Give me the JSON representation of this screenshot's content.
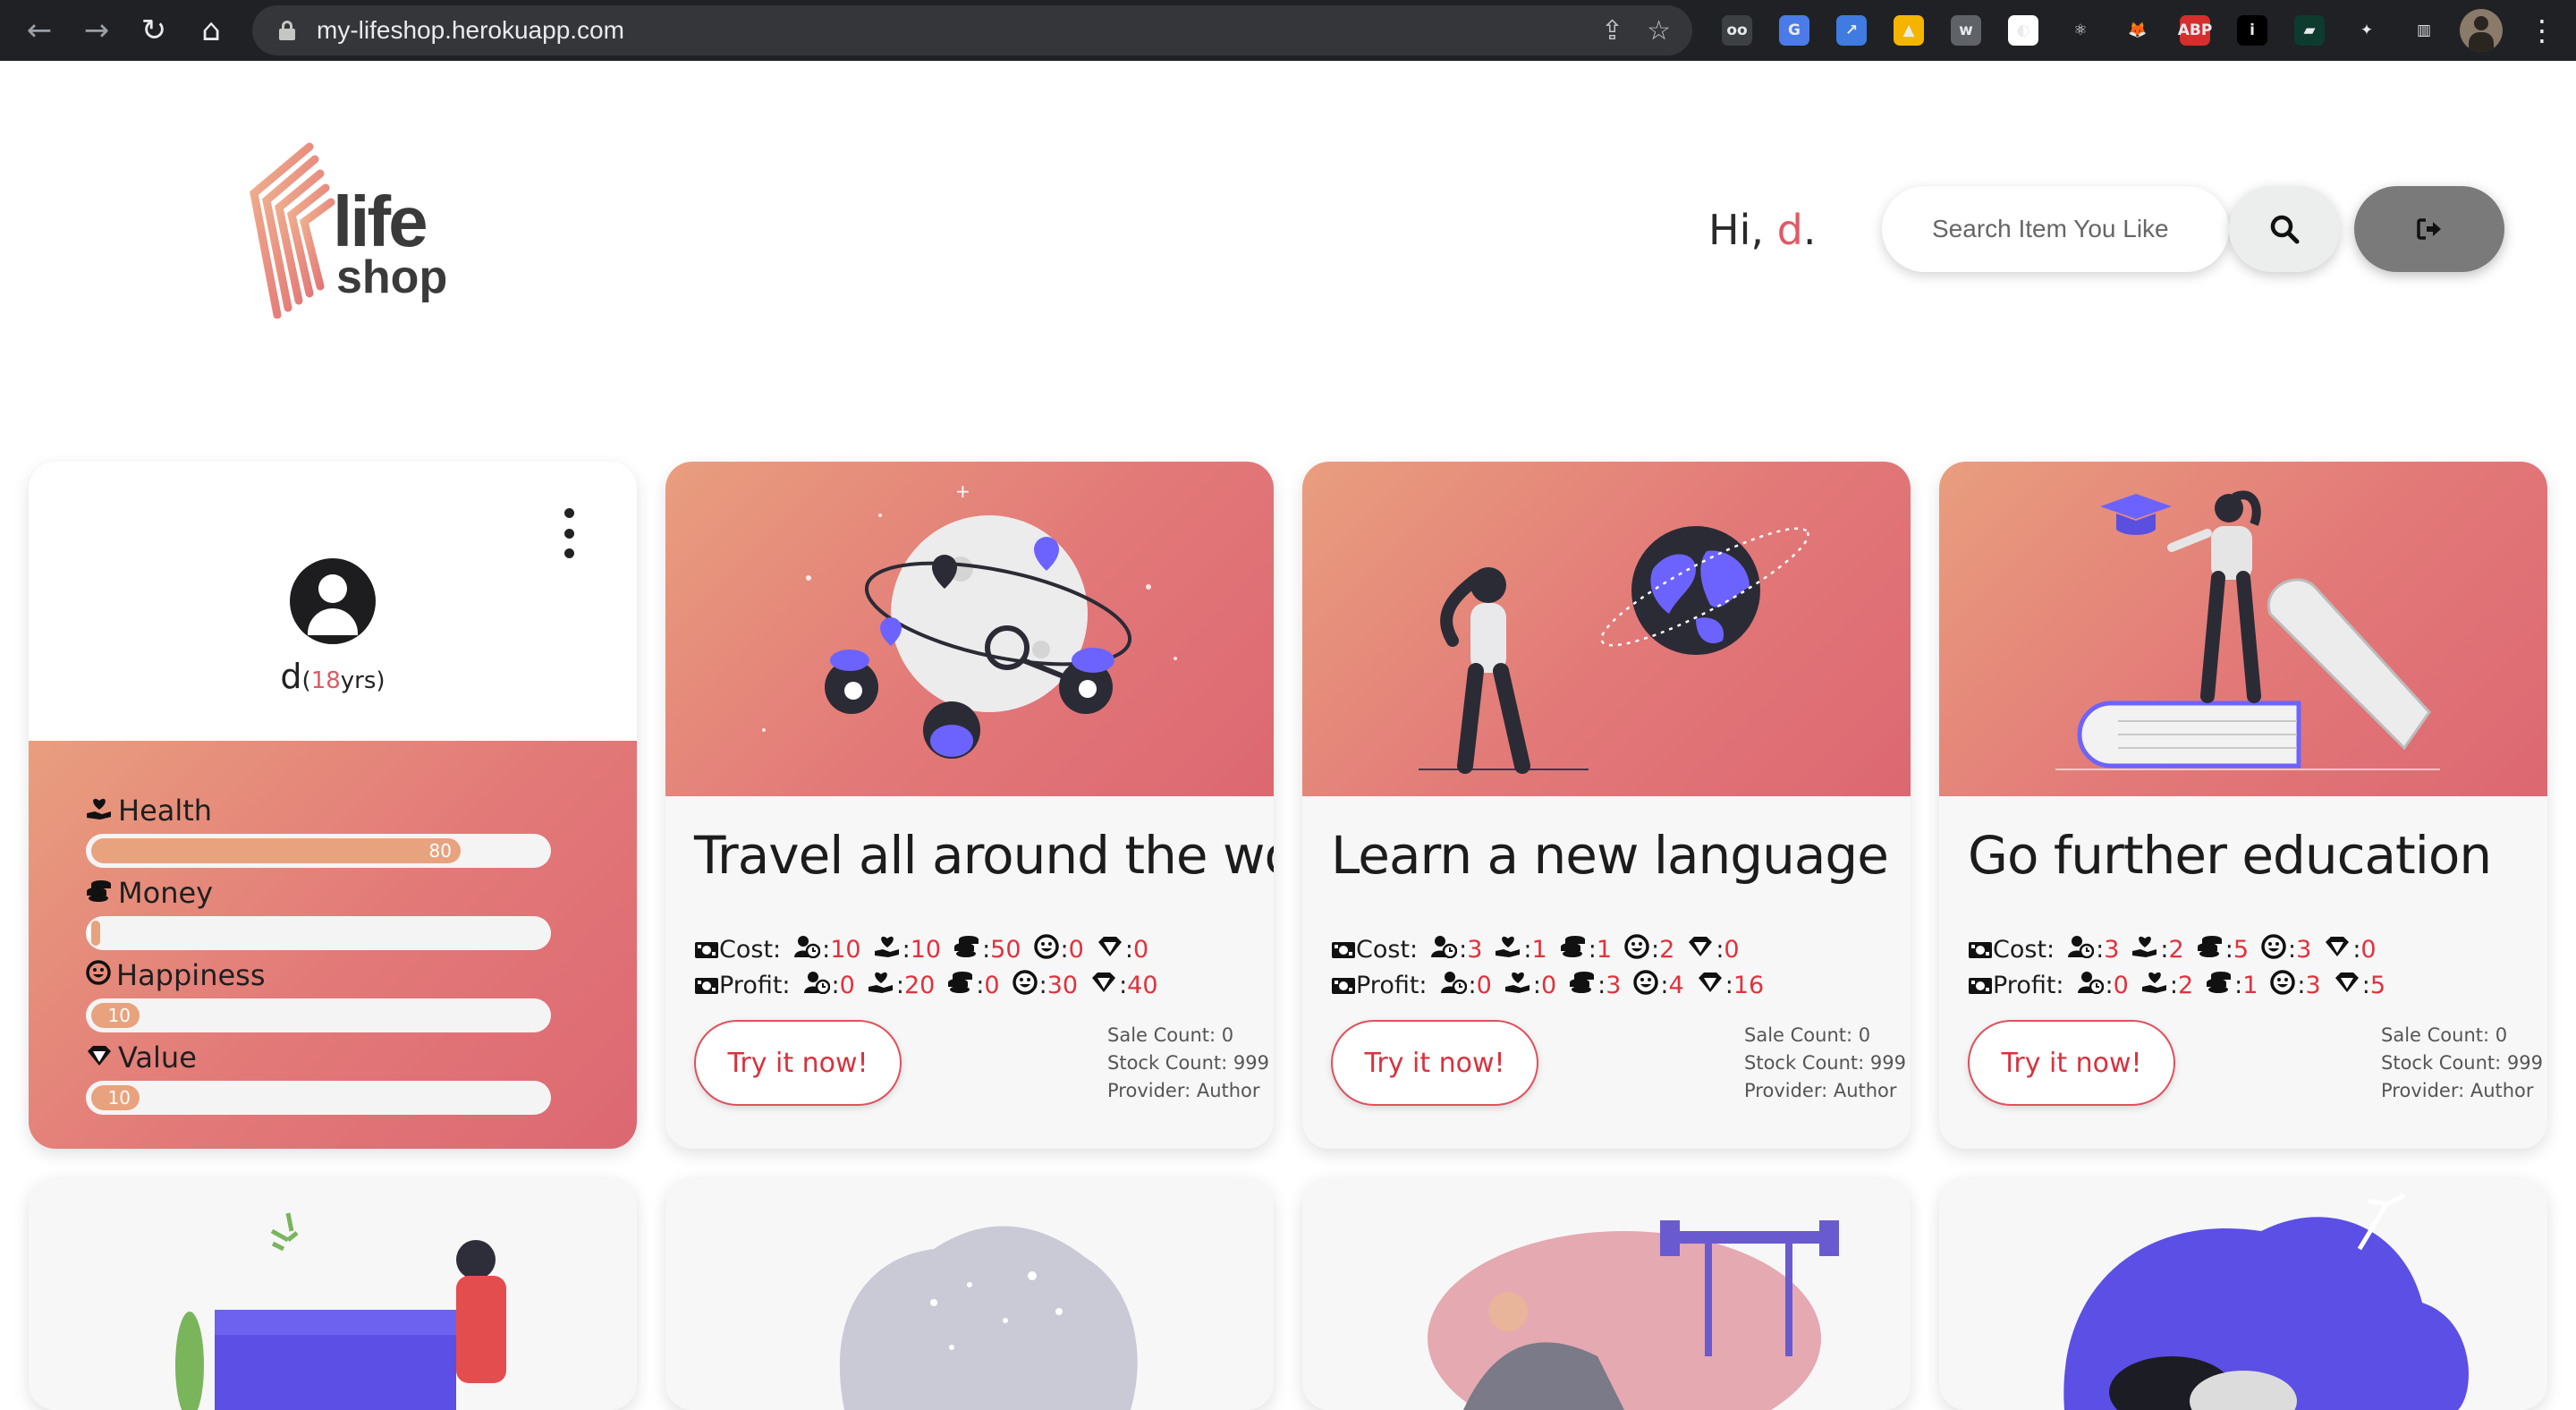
{
  "browser": {
    "url": "my-lifeshop.herokuapp.com",
    "extensions": [
      {
        "icon": "incognito-ext-icon",
        "text": "oo",
        "color": "#3c4043"
      },
      {
        "icon": "translate-ext-icon",
        "text": "G",
        "color": "#4a7be8"
      },
      {
        "icon": "resize-ext-icon",
        "text": "↗",
        "color": "#3f7be0"
      },
      {
        "icon": "drive-ext-icon",
        "text": "▲",
        "color": "#f4b400"
      },
      {
        "icon": "w-ext-icon",
        "text": "w",
        "color": "#5f6368"
      },
      {
        "icon": "circle-ext-icon",
        "text": "◐",
        "color": "#ffffff"
      },
      {
        "icon": "react-ext-icon",
        "text": "⚛",
        "color": "#202124"
      },
      {
        "icon": "fox-ext-icon",
        "text": "🦊",
        "color": "#202124"
      },
      {
        "icon": "adblock-ext-icon",
        "text": "ABP",
        "color": "#d62d2d"
      },
      {
        "icon": "info-ext-icon",
        "text": "i",
        "color": "#000000"
      },
      {
        "icon": "screen-ext-icon",
        "text": "▰",
        "color": "#0d3b2e"
      },
      {
        "icon": "puzzle-ext-icon",
        "text": "✦",
        "color": "#202124"
      },
      {
        "icon": "sidebar-ext-icon",
        "text": "▥",
        "color": "#202124"
      }
    ]
  },
  "header": {
    "logo_line1": "life",
    "logo_line2": "shop",
    "greeting_prefix": "Hi, ",
    "username": "d",
    "greeting_suffix": ".",
    "search_placeholder": "Search Item You Like"
  },
  "profile": {
    "name": "d",
    "age_open": "(",
    "age": "18",
    "age_close": "yrs)",
    "stats": [
      {
        "label": "Health",
        "value": "80",
        "percent": 80,
        "icon": "health-icon"
      },
      {
        "label": "Money",
        "value": "0",
        "percent": 0,
        "icon": "money-icon"
      },
      {
        "label": "Happiness",
        "value": "10",
        "percent": 10,
        "icon": "happiness-icon"
      },
      {
        "label": "Value",
        "value": "10",
        "percent": 10,
        "icon": "value-icon"
      }
    ]
  },
  "items": [
    {
      "title": "Travel all around the world",
      "cost_label": "Cost:",
      "profit_label": "Profit:",
      "cost": [
        "10",
        "10",
        "50",
        "0",
        "0"
      ],
      "profit": [
        "0",
        "20",
        "0",
        "30",
        "40"
      ],
      "button": "Try it now!",
      "sale_count": "Sale Count: 0",
      "stock_count": "Stock Count: 999",
      "provider": "Provider: Author"
    },
    {
      "title": "Learn a new language",
      "cost_label": "Cost:",
      "profit_label": "Profit:",
      "cost": [
        "3",
        "1",
        "1",
        "2",
        "0"
      ],
      "profit": [
        "0",
        "0",
        "3",
        "4",
        "16"
      ],
      "button": "Try it now!",
      "sale_count": "Sale Count: 0",
      "stock_count": "Stock Count: 999",
      "provider": "Provider: Author"
    },
    {
      "title": "Go further education",
      "cost_label": "Cost:",
      "profit_label": "Profit:",
      "cost": [
        "3",
        "2",
        "5",
        "3",
        "0"
      ],
      "profit": [
        "0",
        "2",
        "1",
        "3",
        "5"
      ],
      "button": "Try it now!",
      "sale_count": "Sale Count: 0",
      "stock_count": "Stock Count: 999",
      "provider": "Provider: Author"
    }
  ],
  "stat_icons": [
    "time-icon",
    "health-icon",
    "money-icon",
    "happiness-icon",
    "value-icon"
  ],
  "colors": {
    "accent": "#e05a66",
    "gradient_start": "#e99e7e",
    "gradient_end": "#dc6872",
    "bar_fill": "#e9a27e",
    "number_red": "#e0323c"
  }
}
